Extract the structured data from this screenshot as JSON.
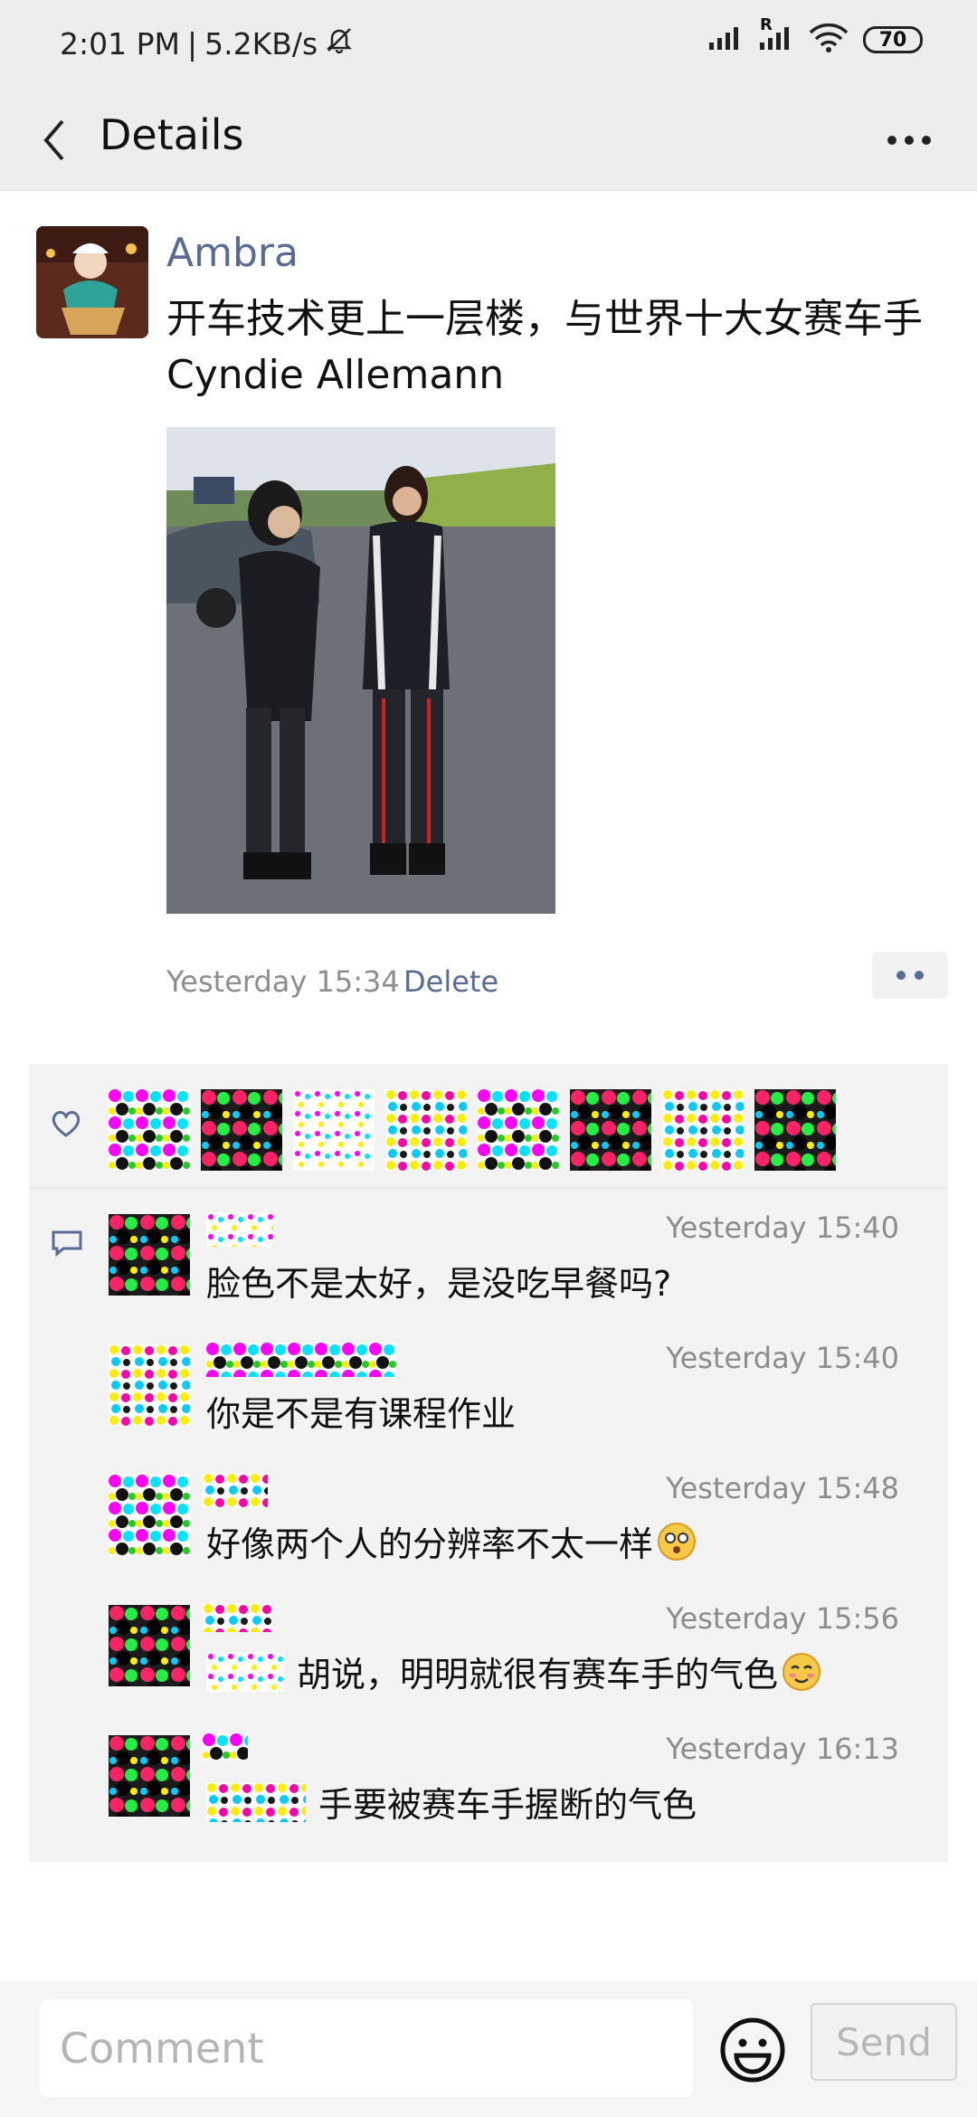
{
  "status_bar": {
    "time": "2:01 PM",
    "speed": "5.2KB/s",
    "battery": "70",
    "roaming_mark": "R"
  },
  "header": {
    "title": "Details"
  },
  "post": {
    "author": "Ambra",
    "text_line1": "开车技术更上一层楼，与世界十大女赛车手",
    "text_line2": "Cyndie Allemann",
    "time": "Yesterday 15:34",
    "delete_label": "Delete"
  },
  "likes": {
    "count_visible": 8
  },
  "comments": [
    {
      "time": "Yesterday 15:40",
      "text": "脸色不是太好，是没吃早餐吗?"
    },
    {
      "time": "Yesterday 15:40",
      "text": "你是不是有课程作业"
    },
    {
      "time": "Yesterday 15:48",
      "text": "好像两个人的分辨率不太一样"
    },
    {
      "time": "Yesterday 15:56",
      "text": "胡说，明明就很有赛车手的气色"
    },
    {
      "time": "Yesterday 16:13",
      "text": "手要被赛车手握断的气色"
    }
  ],
  "input": {
    "placeholder": "Comment",
    "send_label": "Send"
  },
  "colors": {
    "link": "#576b95",
    "meta": "#8d8d8d",
    "header_bg": "#ededed"
  }
}
